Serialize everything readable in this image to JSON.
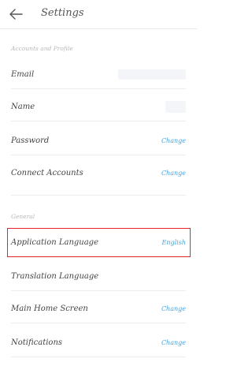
{
  "header": {
    "title": "Settings"
  },
  "sections": {
    "accounts_label": "Accounts and Profile",
    "general_label": "General"
  },
  "accounts_items": [
    {
      "label": "Email",
      "action": ""
    },
    {
      "label": "Name",
      "action": ""
    },
    {
      "label": "Password",
      "action": "Change"
    },
    {
      "label": "Connect Accounts",
      "action": "Change"
    }
  ],
  "general_items": [
    {
      "label": "Application Language",
      "action": "English"
    },
    {
      "label": "Translation Language",
      "action": ""
    },
    {
      "label": "Main Home Screen",
      "action": "Change"
    },
    {
      "label": "Notifications",
      "action": "Change"
    }
  ],
  "colors": {
    "accent": "#4aa3d9",
    "highlight": "#e3262e"
  }
}
